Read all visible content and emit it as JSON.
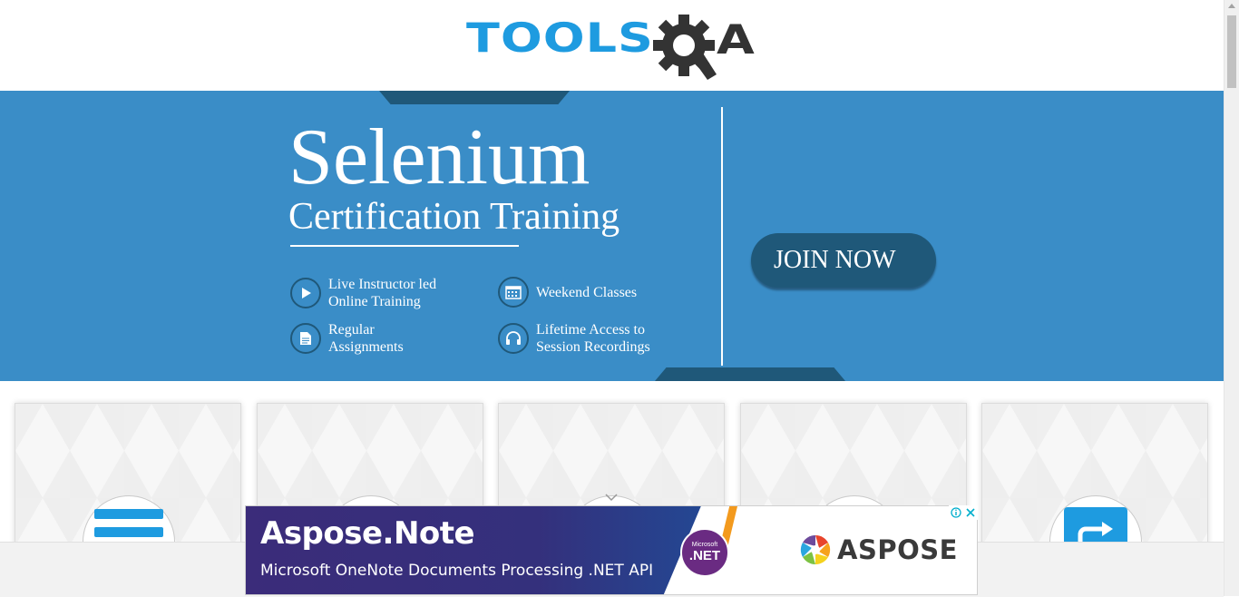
{
  "header": {
    "logo_text_primary": "TOOLS",
    "logo_text_secondary": "A",
    "logo_icon": "gear-q-icon",
    "colors": {
      "logo_blue": "#1e9be0",
      "logo_dark": "#333333"
    }
  },
  "banner": {
    "title": "Selenium",
    "subtitle": "Certification Training",
    "features": [
      {
        "icon": "play-icon",
        "line1": "Live Instructor led",
        "line2": "Online Training"
      },
      {
        "icon": "calendar-icon",
        "line1": "Weekend Classes",
        "line2": ""
      },
      {
        "icon": "document-icon",
        "line1": "Regular",
        "line2": "Assignments"
      },
      {
        "icon": "headphones-icon",
        "line1": "Lifetime Access to",
        "line2": "Session Recordings"
      }
    ],
    "cta_label": "JOIN NOW",
    "colors": {
      "background": "#3a8dc7",
      "dark": "#1f5879"
    }
  },
  "cards": [
    {
      "icon": "elements-icon"
    },
    {
      "icon": "forms-icon"
    },
    {
      "icon": "alerts-icon"
    },
    {
      "icon": "widgets-icon"
    },
    {
      "icon": "interactions-icon"
    }
  ],
  "ad": {
    "title": "Aspose.Note",
    "subtitle": "Microsoft OneNote Documents Processing .NET API",
    "badge_small": "Microsoft",
    "badge_big": ".NET",
    "brand": "ASPOSE",
    "info_icon": "info-icon",
    "close_icon": "close-icon"
  }
}
